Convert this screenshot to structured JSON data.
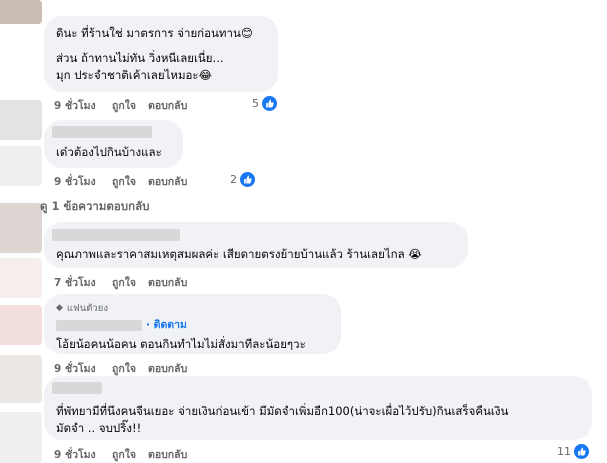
{
  "comments": [
    {
      "lines": [
        "ดินะ ที่ร้านใช่ มาตรการ จ่ายก่อนทาน😊",
        "",
        "ส่วน ถ้าทานไม่ทัน วิ่งหนีเลยเนี่ย...",
        "มุก ประจำชาติเค้าเลยไหมอะ😂"
      ],
      "time": "9 ชั่วโมง",
      "like": "ถูกใจ",
      "reply": "ตอบกลับ",
      "reactions": "5"
    },
    {
      "lines": [
        "เด๋วต้องไปกินบ้างและ"
      ],
      "time": "9 ชั่วโมง",
      "like": "ถูกใจ",
      "reply": "ตอบกลับ",
      "reactions": "2"
    },
    {
      "lines": [
        "คุณภาพและราคาสมเหตุสมผลค่ะ เสียดายตรงย้ายบ้านแล้ว ร้านเลยไกล 😭"
      ],
      "time": "7 ชั่วโมง",
      "like": "ถูกใจ",
      "reply": "ตอบกลับ",
      "reactions": ""
    },
    {
      "badge": "แฟนตัวยง",
      "follow": "· ติดตาม",
      "lines": [
        "โอ้ยน้อคนน้อคน ตอนกินทำไมไม่สั่งมาทีละน้อยๆวะ"
      ],
      "time": "9 ชั่วโมง",
      "like": "ถูกใจ",
      "reply": "ตอบกลับ",
      "reactions": ""
    },
    {
      "lines": [
        "ที่พัทยามีที่นึงคนจีนเยอะ จ่ายเงินก่อนเข้า มีมัดจำเพิ่มอีก100(น่าจะเผื่อไว้ปรับ)กินเสร็จคืนเงิน",
        "มัดจำ .. จบปริ๊ง!!"
      ],
      "time": "9 ชั่วโมง",
      "like": "ถูกใจ",
      "reply": "ตอบกลับ",
      "reactions": "11"
    }
  ],
  "view_more_replies": "ดู 1 ข้อความตอบกลับ",
  "colors": {
    "accent": "#1877f2",
    "bubble": "#f0f2f5",
    "muted": "#65676b"
  }
}
